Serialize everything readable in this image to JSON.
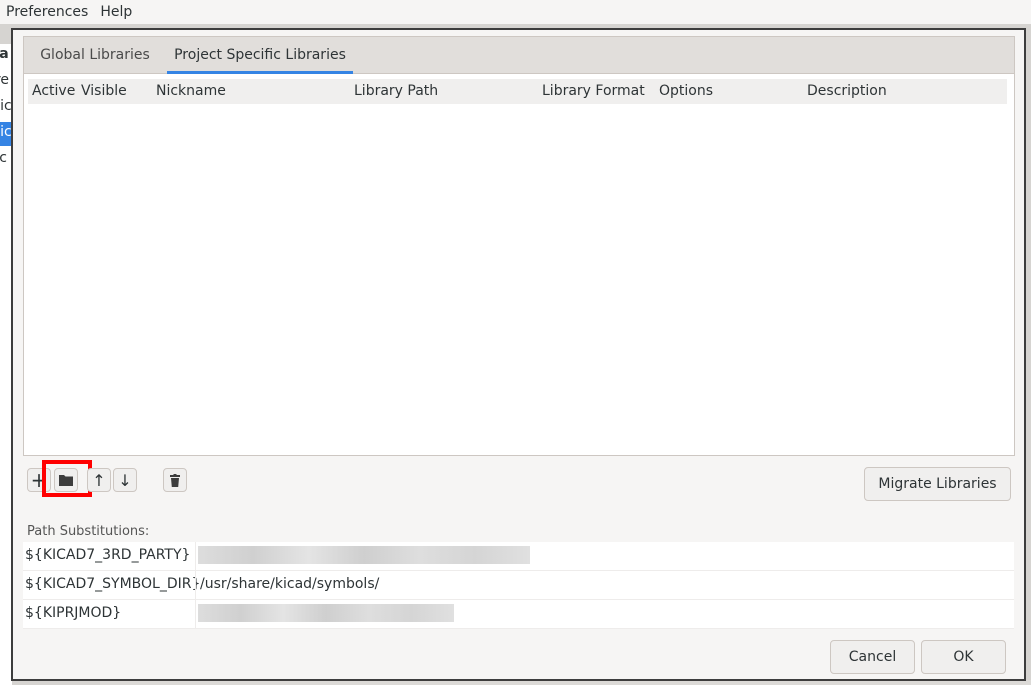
{
  "menubar": {
    "items": [
      "Preferences",
      "Help"
    ]
  },
  "background_window": {
    "sidebar_fragments": [
      "ca",
      "pre",
      "kic",
      "kic",
      "sc"
    ]
  },
  "dialog": {
    "tabs": [
      {
        "label": "Global Libraries",
        "active": false
      },
      {
        "label": "Project Specific Libraries",
        "active": true
      }
    ],
    "grid": {
      "columns": [
        "Active",
        "Visible",
        "Nickname",
        "Library Path",
        "Library Format",
        "Options",
        "Description"
      ],
      "rows": []
    },
    "toolbar": {
      "add": "+",
      "browse": "folder-icon",
      "up": "↑",
      "down": "↓",
      "delete": "trash-icon"
    },
    "migrate_label": "Migrate Libraries",
    "path_substitutions": {
      "label": "Path Substitutions:",
      "rows": [
        {
          "name": "${KICAD7_3RD_PARTY}",
          "value": null,
          "redacted": true
        },
        {
          "name": "${KICAD7_SYMBOL_DIR}",
          "value": "/usr/share/kicad/symbols/",
          "redacted": false
        },
        {
          "name": "${KIPRJMOD}",
          "value": null,
          "redacted": true
        }
      ]
    },
    "cancel_label": "Cancel",
    "ok_label": "OK"
  },
  "colors": {
    "accent": "#3584e4",
    "highlight": "#ff0000"
  }
}
